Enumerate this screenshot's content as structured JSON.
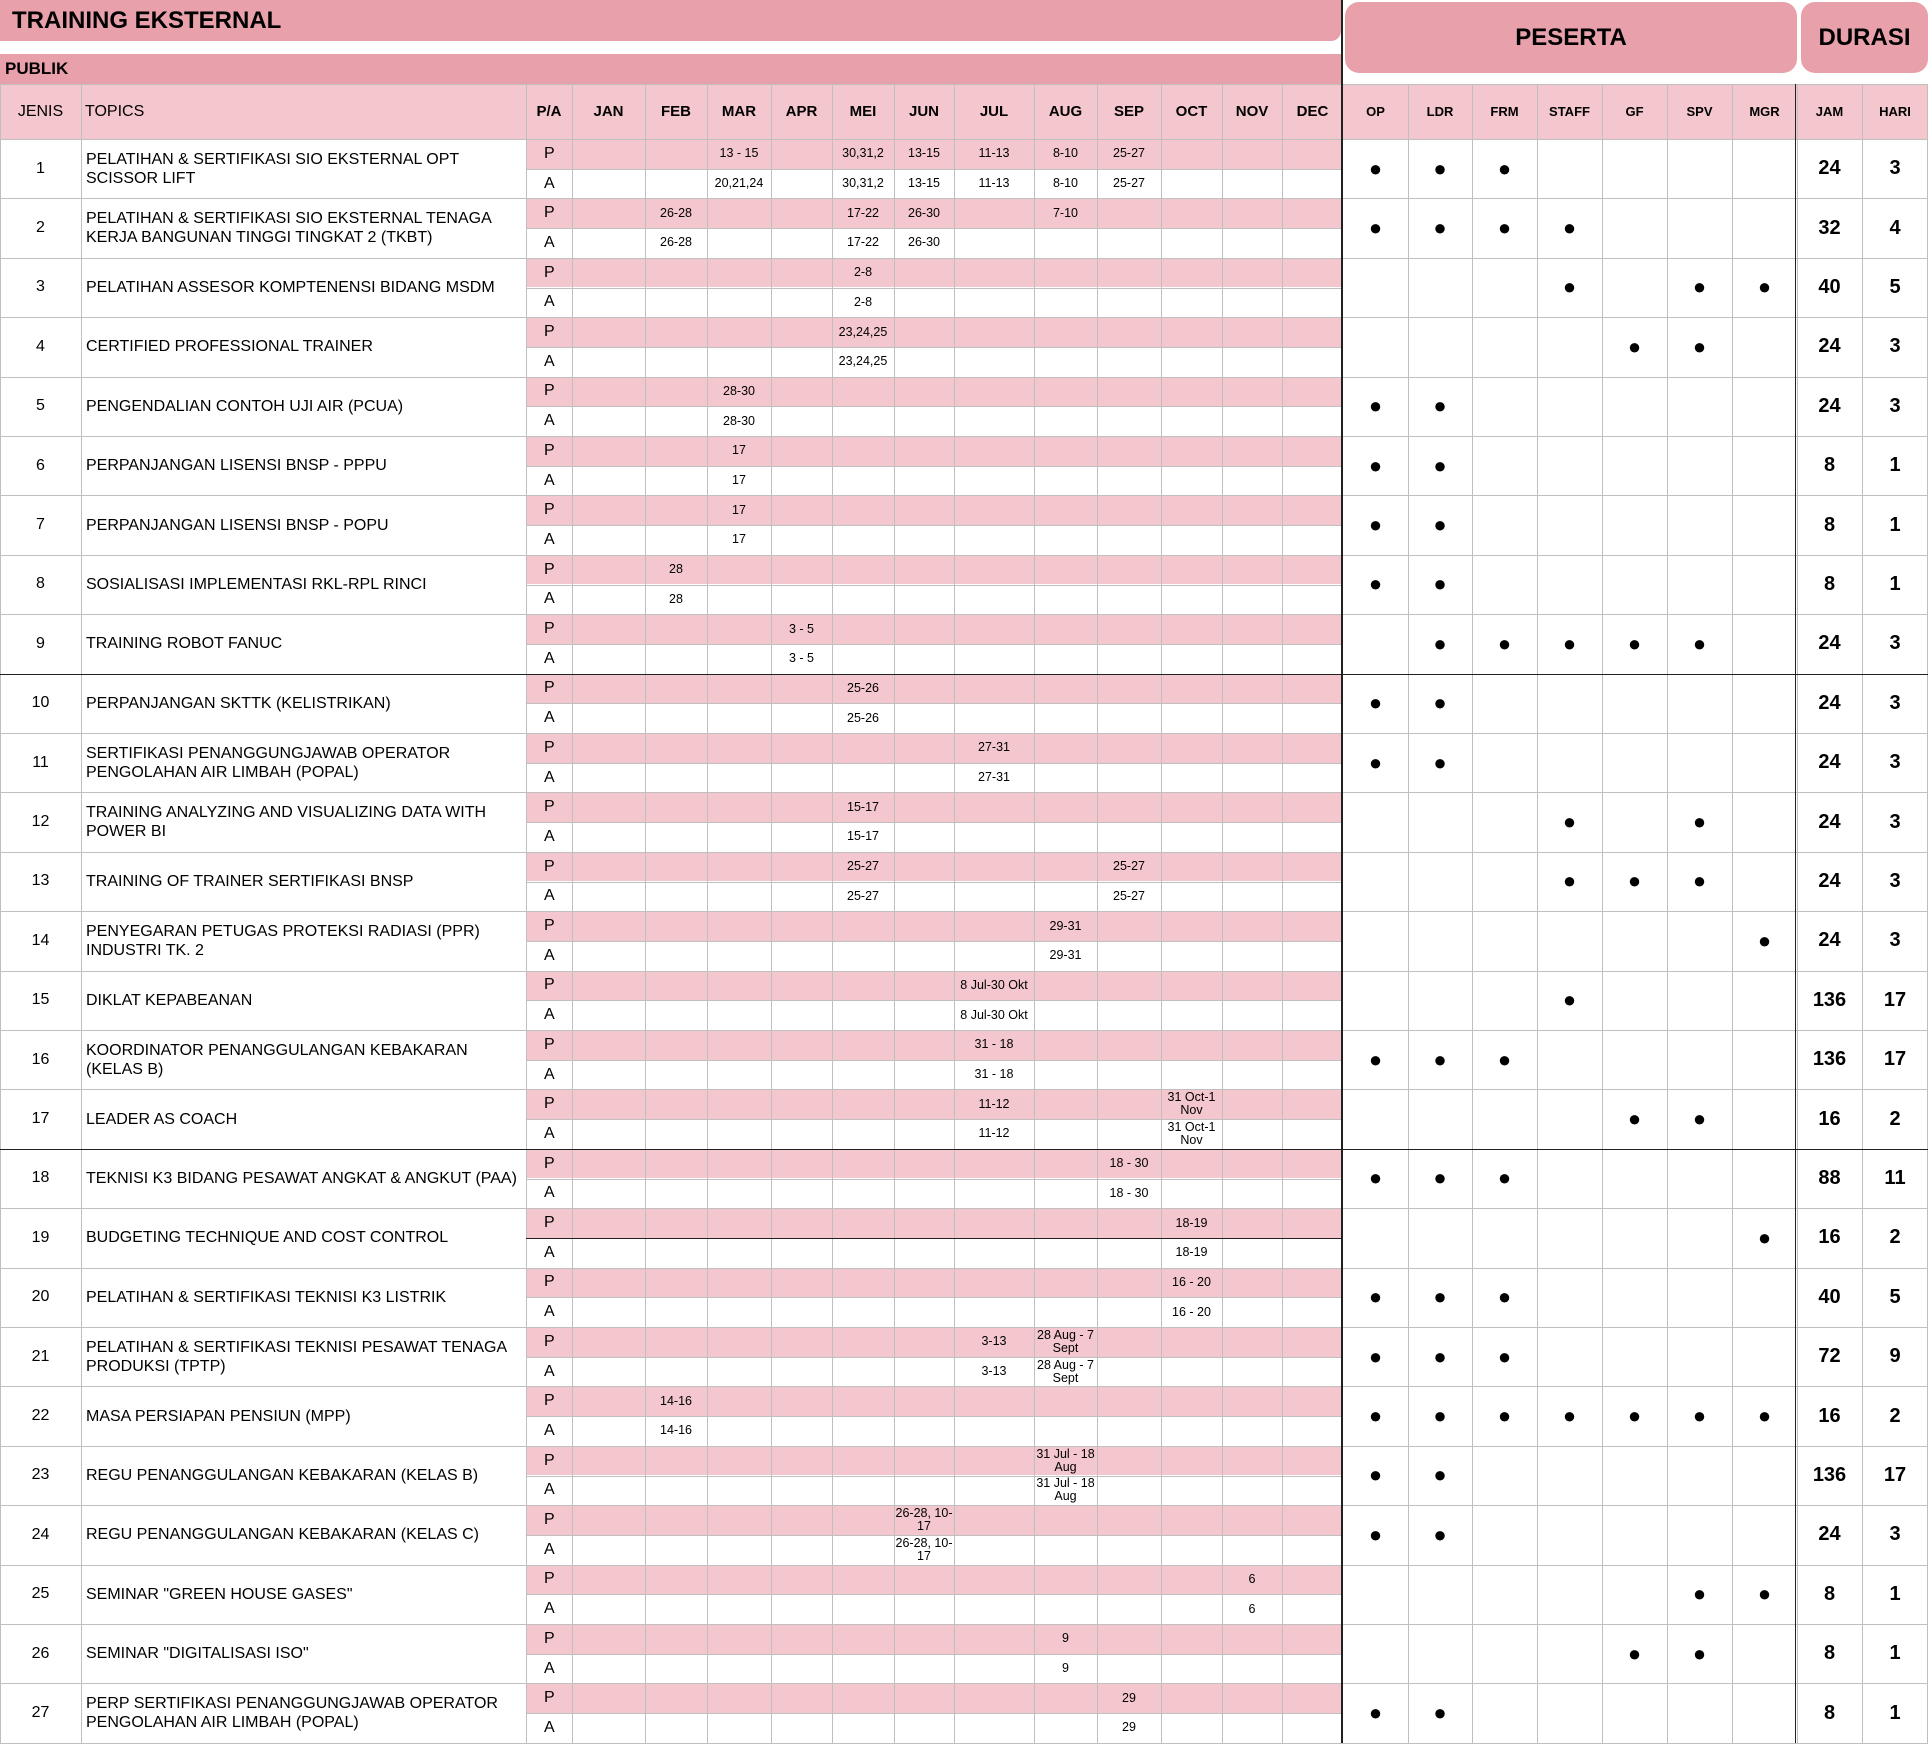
{
  "title": "TRAINING EKSTERNAL",
  "section": "PUBLIK",
  "group_headers": {
    "peserta": "PESERTA",
    "durasi": "DURASI"
  },
  "headers": {
    "jenis": "JENIS",
    "topics": "TOPICS",
    "pa": "P/A",
    "months": [
      "JAN",
      "FEB",
      "MAR",
      "APR",
      "MEI",
      "JUN",
      "JUL",
      "AUG",
      "SEP",
      "OCT",
      "NOV",
      "DEC"
    ],
    "participants": [
      "OP",
      "LDR",
      "FRM",
      "STAFF",
      "GF",
      "SPV",
      "MGR"
    ],
    "jam": "JAM",
    "hari": "HARI"
  },
  "labels": {
    "plan": "P",
    "actual": "A",
    "dot": "●"
  },
  "colors": {
    "title_bg": "#e8a1ab",
    "header_bg": "#f4c6cd",
    "plan_row_bg": "#f4c6cd"
  },
  "rows": [
    {
      "no": "1",
      "topic": "PELATIHAN & SERTIFIKASI SIO EKSTERNAL OPT SCISSOR LIFT",
      "P": {
        "MAR": "13 - 15",
        "MEI": "30,31,2",
        "JUN": "13-15",
        "JUL": "11-13",
        "AUG": "8-10",
        "SEP": "25-27"
      },
      "A": {
        "MAR": "20,21,24",
        "MEI": "30,31,2",
        "JUN": "13-15",
        "JUL": "11-13",
        "AUG": "8-10",
        "SEP": "25-27"
      },
      "peserta": [
        "OP",
        "LDR",
        "FRM"
      ],
      "jam": "24",
      "hari": "3"
    },
    {
      "no": "2",
      "topic": "PELATIHAN & SERTIFIKASI SIO EKSTERNAL TENAGA KERJA BANGUNAN TINGGI TINGKAT 2 (TKBT)",
      "P": {
        "FEB": "26-28",
        "MEI": "17-22",
        "JUN": "26-30",
        "AUG": "7-10"
      },
      "A": {
        "FEB": "26-28",
        "MEI": "17-22",
        "JUN": "26-30"
      },
      "peserta": [
        "OP",
        "LDR",
        "FRM",
        "STAFF"
      ],
      "jam": "32",
      "hari": "4"
    },
    {
      "no": "3",
      "topic": "PELATIHAN ASSESOR KOMPTENENSI BIDANG MSDM",
      "P": {
        "MEI": "2-8"
      },
      "A": {
        "MEI": "2-8"
      },
      "peserta": [
        "STAFF",
        "SPV",
        "MGR"
      ],
      "jam": "40",
      "hari": "5"
    },
    {
      "no": "4",
      "topic": "CERTIFIED PROFESSIONAL TRAINER",
      "P": {
        "MEI": "23,24,25"
      },
      "A": {
        "MEI": "23,24,25"
      },
      "peserta": [
        "GF",
        "SPV"
      ],
      "jam": "24",
      "hari": "3"
    },
    {
      "no": "5",
      "topic": "PENGENDALIAN CONTOH UJI AIR (PCUA)",
      "P": {
        "MAR": "28-30"
      },
      "A": {
        "MAR": "28-30"
      },
      "peserta": [
        "OP",
        "LDR"
      ],
      "jam": "24",
      "hari": "3"
    },
    {
      "no": "6",
      "topic": "PERPANJANGAN LISENSI BNSP - PPPU",
      "P": {
        "MAR": "17"
      },
      "A": {
        "MAR": "17"
      },
      "peserta": [
        "OP",
        "LDR"
      ],
      "jam": "8",
      "hari": "1"
    },
    {
      "no": "7",
      "topic": "PERPANJANGAN LISENSI BNSP - POPU",
      "P": {
        "MAR": "17"
      },
      "A": {
        "MAR": "17"
      },
      "peserta": [
        "OP",
        "LDR"
      ],
      "jam": "8",
      "hari": "1"
    },
    {
      "no": "8",
      "topic": "SOSIALISASI IMPLEMENTASI RKL-RPL RINCI",
      "P": {
        "FEB": "28"
      },
      "A": {
        "FEB": "28"
      },
      "peserta": [
        "OP",
        "LDR"
      ],
      "jam": "8",
      "hari": "1"
    },
    {
      "no": "9",
      "topic": "TRAINING ROBOT FANUC",
      "P": {
        "APR": "3 - 5"
      },
      "A": {
        "APR": "3 - 5"
      },
      "peserta": [
        "LDR",
        "FRM",
        "STAFF",
        "GF",
        "SPV"
      ],
      "jam": "24",
      "hari": "3"
    },
    {
      "no": "10",
      "topic": "PERPANJANGAN SKTTK (KELISTRIKAN)",
      "P": {
        "MEI": "25-26"
      },
      "A": {
        "MEI": "25-26"
      },
      "peserta": [
        "OP",
        "LDR"
      ],
      "jam": "24",
      "hari": "3"
    },
    {
      "no": "11",
      "topic": "SERTIFIKASI PENANGGUNGJAWAB OPERATOR PENGOLAHAN AIR LIMBAH (POPAL)",
      "P": {
        "JUL": "27-31"
      },
      "A": {
        "JUL": "27-31"
      },
      "peserta": [
        "OP",
        "LDR"
      ],
      "jam": "24",
      "hari": "3"
    },
    {
      "no": "12",
      "topic": "TRAINING ANALYZING AND VISUALIZING DATA WITH POWER BI",
      "P": {
        "MEI": "15-17"
      },
      "A": {
        "MEI": "15-17"
      },
      "peserta": [
        "STAFF",
        "SPV"
      ],
      "jam": "24",
      "hari": "3"
    },
    {
      "no": "13",
      "topic": "TRAINING OF TRAINER SERTIFIKASI BNSP",
      "P": {
        "MEI": "25-27",
        "SEP": "25-27"
      },
      "A": {
        "MEI": "25-27",
        "SEP": "25-27"
      },
      "peserta": [
        "STAFF",
        "GF",
        "SPV"
      ],
      "jam": "24",
      "hari": "3"
    },
    {
      "no": "14",
      "topic": "PENYEGARAN PETUGAS PROTEKSI RADIASI (PPR) INDUSTRI TK. 2",
      "P": {
        "AUG": "29-31"
      },
      "A": {
        "AUG": "29-31"
      },
      "peserta": [
        "MGR"
      ],
      "jam": "24",
      "hari": "3"
    },
    {
      "no": "15",
      "topic": "DIKLAT KEPABEANAN",
      "P": {
        "JUL": "8 Jul-30 Okt"
      },
      "A": {
        "JUL": "8 Jul-30 Okt"
      },
      "peserta": [
        "STAFF"
      ],
      "jam": "136",
      "hari": "17"
    },
    {
      "no": "16",
      "topic": "KOORDINATOR PENANGGULANGAN KEBAKARAN (KELAS B)",
      "P": {
        "JUL": "31 - 18"
      },
      "A": {
        "JUL": "31 - 18"
      },
      "peserta": [
        "OP",
        "LDR",
        "FRM"
      ],
      "jam": "136",
      "hari": "17"
    },
    {
      "no": "17",
      "topic": "LEADER AS COACH",
      "P": {
        "JUL": "11-12",
        "OCT": "31 Oct-1 Nov"
      },
      "A": {
        "JUL": "11-12",
        "OCT": "31 Oct-1 Nov"
      },
      "peserta": [
        "GF",
        "SPV"
      ],
      "jam": "16",
      "hari": "2"
    },
    {
      "no": "18",
      "topic": "TEKNISI K3 BIDANG PESAWAT ANGKAT & ANGKUT (PAA)",
      "P": {
        "SEP": "18 - 30"
      },
      "A": {
        "SEP": "18 - 30"
      },
      "peserta": [
        "OP",
        "LDR",
        "FRM"
      ],
      "jam": "88",
      "hari": "11"
    },
    {
      "no": "19",
      "topic": "BUDGETING TECHNIQUE AND COST CONTROL",
      "P": {
        "OCT": "18-19"
      },
      "A": {
        "OCT": "18-19"
      },
      "peserta": [
        "MGR"
      ],
      "jam": "16",
      "hari": "2"
    },
    {
      "no": "20",
      "topic": "PELATIHAN & SERTIFIKASI TEKNISI K3 LISTRIK",
      "P": {
        "OCT": "16 - 20"
      },
      "A": {
        "OCT": "16 - 20"
      },
      "peserta": [
        "OP",
        "LDR",
        "FRM"
      ],
      "jam": "40",
      "hari": "5"
    },
    {
      "no": "21",
      "topic": "PELATIHAN & SERTIFIKASI TEKNISI PESAWAT TENAGA PRODUKSI (TPTP)",
      "P": {
        "JUL": "3-13",
        "AUG": "28 Aug - 7 Sept"
      },
      "A": {
        "JUL": "3-13",
        "AUG": "28 Aug - 7 Sept"
      },
      "peserta": [
        "OP",
        "LDR",
        "FRM"
      ],
      "jam": "72",
      "hari": "9"
    },
    {
      "no": "22",
      "topic": "MASA PERSIAPAN PENSIUN (MPP)",
      "P": {
        "FEB": "14-16"
      },
      "A": {
        "FEB": "14-16"
      },
      "peserta": [
        "OP",
        "LDR",
        "FRM",
        "STAFF",
        "GF",
        "SPV",
        "MGR"
      ],
      "jam": "16",
      "hari": "2"
    },
    {
      "no": "23",
      "topic": "REGU PENANGGULANGAN KEBAKARAN (KELAS B)",
      "P": {
        "AUG": "31 Jul - 18 Aug"
      },
      "A": {
        "AUG": "31 Jul - 18 Aug"
      },
      "peserta": [
        "OP",
        "LDR"
      ],
      "jam": "136",
      "hari": "17"
    },
    {
      "no": "24",
      "topic": "REGU PENANGGULANGAN KEBAKARAN (KELAS C)",
      "P": {
        "JUN": "26-28, 10-17"
      },
      "A": {
        "JUN": "26-28, 10-17"
      },
      "peserta": [
        "OP",
        "LDR"
      ],
      "jam": "24",
      "hari": "3"
    },
    {
      "no": "25",
      "topic": "SEMINAR \"GREEN HOUSE GASES\"",
      "P": {
        "NOV": "6"
      },
      "A": {
        "NOV": "6"
      },
      "peserta": [
        "SPV",
        "MGR"
      ],
      "jam": "8",
      "hari": "1"
    },
    {
      "no": "26",
      "topic": "SEMINAR \"DIGITALISASI ISO\"",
      "P": {
        "AUG": "9"
      },
      "A": {
        "AUG": "9"
      },
      "peserta": [
        "GF",
        "SPV"
      ],
      "jam": "8",
      "hari": "1"
    },
    {
      "no": "27",
      "topic": "PERP SERTIFIKASI PENANGGUNGJAWAB OPERATOR PENGOLAHAN AIR LIMBAH (POPAL)",
      "P": {
        "SEP": "29"
      },
      "A": {
        "SEP": "29"
      },
      "peserta": [
        "OP",
        "LDR"
      ],
      "jam": "8",
      "hari": "1"
    }
  ]
}
